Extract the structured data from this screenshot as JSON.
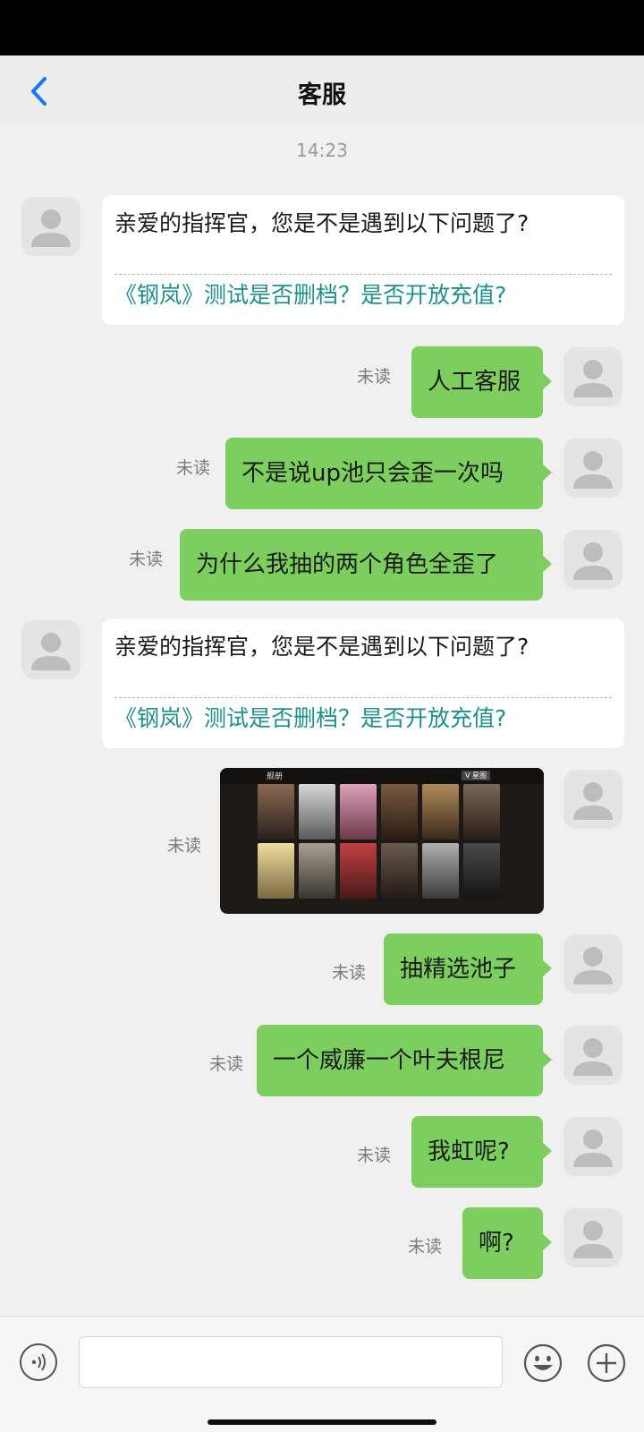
{
  "header": {
    "title": "客服",
    "back_icon": "chevron-left-icon",
    "accent": "#1677ff"
  },
  "chat": {
    "timestamp": "14:23",
    "unread_label": "未读",
    "greeting_1": {
      "question": "亲爱的指挥官，您是不是遇到以下问题了?",
      "link": "《钢岚》测试是否删档？是否开放充值?"
    },
    "greeting_2": {
      "question": "亲爱的指挥官，您是不是遇到以下问题了?",
      "link": "《钢岚》测试是否删档？是否开放充值?"
    },
    "outgoing": [
      "人工客服",
      "不是说up池只会歪一次吗",
      "为什么我抽的两个角色全歪了",
      "抽精选池子",
      "一个威廉一个叶夫根尼",
      "我虹呢?",
      "啊?"
    ],
    "image_message": {
      "description_icon": "game-screenshot-image",
      "screenshot_title": "舰册",
      "screenshot_tab": "V 星图"
    }
  },
  "colors": {
    "outgoing_bubble": "#7ccf5f",
    "link": "#1f8f8a",
    "background": "#f0f0f0"
  },
  "input": {
    "voice_icon": "voice-icon",
    "emoji_icon": "emoji-icon",
    "plus_icon": "plus-icon"
  }
}
